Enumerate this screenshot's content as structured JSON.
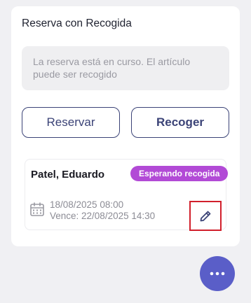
{
  "card": {
    "title": "Reserva con Recogida",
    "info_text": "La reserva está en curso. El artículo puede ser recogido",
    "reserve_button": "Reservar",
    "pickup_button": "Recoger"
  },
  "reservation": {
    "name": "Patel, Eduardo",
    "status": "Esperando recogida",
    "start": "18/08/2025 08:00",
    "due": "Vence: 22/08/2025 14:30",
    "icons": {
      "calendar": "calendar-icon",
      "edit": "pencil-icon"
    }
  },
  "fab": {
    "icon": "more-dots-icon"
  },
  "colors": {
    "background": "#f0f0f3",
    "accent": "#3b4377",
    "status_badge": "#b24ad6",
    "highlight_border": "#d11f2b",
    "fab": "#5a5ec8"
  }
}
